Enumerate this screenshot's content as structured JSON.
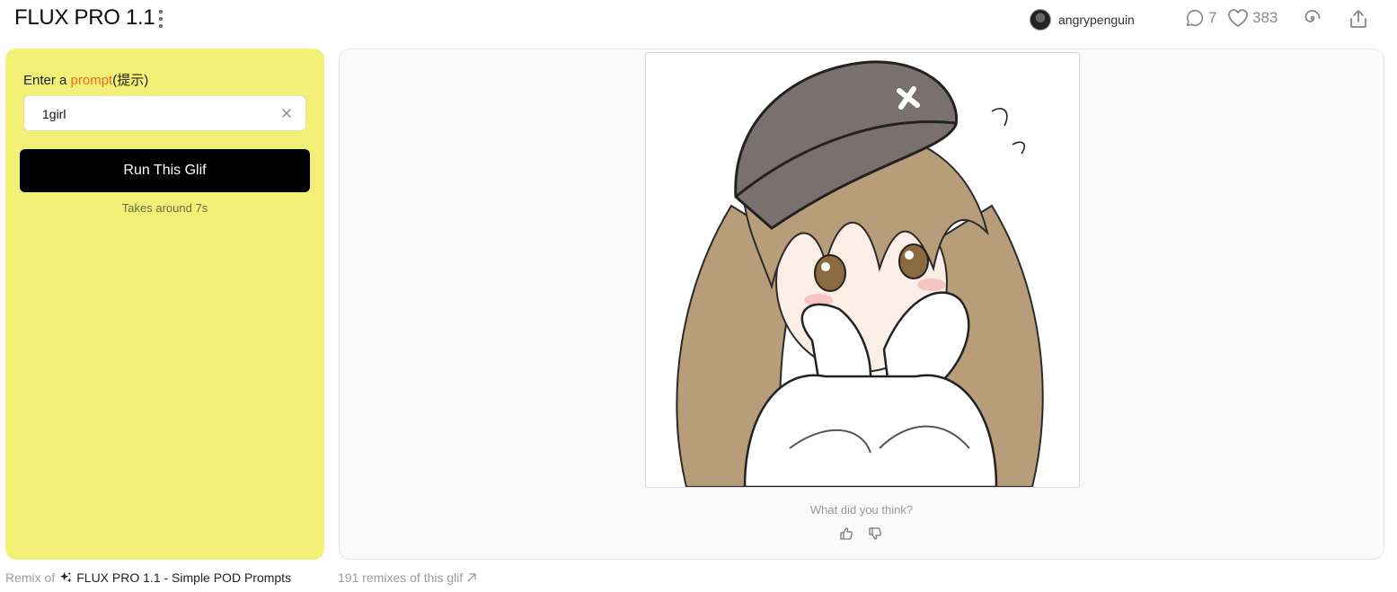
{
  "header": {
    "title": "FLUX PRO 1.1",
    "username": "angrypenguin",
    "comments_count": "7",
    "likes_count": "383",
    "icons": {
      "more": "kebab-menu-icon",
      "comments": "speech-bubble-icon",
      "likes": "heart-icon",
      "remix": "spiral-icon",
      "share": "share-upload-icon"
    }
  },
  "form": {
    "prompt_prefix": "Enter a ",
    "prompt_word": "prompt",
    "prompt_suffix": "(提示)",
    "input_value": "1girl",
    "run_label": "Run This Glif",
    "eta": "Takes around 7s"
  },
  "result": {
    "image_alt": "anime girl with long brown hair and grey cap covering mouth with sleeves",
    "feedback_prompt": "What did you think?"
  },
  "footer": {
    "remix_prefix": "Remix of",
    "remix_source": "FLUX PRO 1.1 - Simple POD Prompts",
    "remix_count": "191 remixes of this glif"
  },
  "colors": {
    "panel_bg": "#f2f077",
    "accent": "#f26a1b",
    "button_bg": "#000000"
  }
}
